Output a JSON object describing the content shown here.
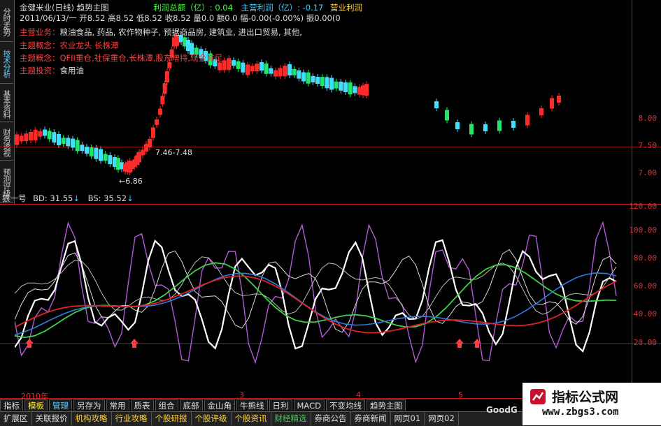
{
  "left_tabs": [
    {
      "label": "分时走势"
    },
    {
      "label": "技术分析"
    },
    {
      "label": "基本资料"
    },
    {
      "label": "财务透视"
    },
    {
      "label": "预测评级"
    }
  ],
  "header": {
    "stock": "金健米业(日线)",
    "view": "趋势主图",
    "fin1_label": "利润总额（亿）",
    "fin1_value": ": 0.04",
    "fin2_label": "主营利润（亿）",
    "fin2_value": ": -0.17",
    "fin3_label": "营业利润",
    "ohlc": "2011/06/13/一 开8.52 高8.52 低8.52 收8.52 量0.0 额0.0 幅-0.00(-0.00%) 振0.00(0",
    "business_label": "主营业务：",
    "business": "粮油食品, 药品, 农作物种子, 预据商品房, 建筑业, 进出口贸易, 其他,",
    "concept1_label": "主题概念：",
    "concept1": "农业龙头 长株潭",
    "concept2_label": "主题概念：",
    "concept2": "QFII重仓,社保重仓,长株潭,股东增持,现金充足",
    "invest_label": "主题投资：",
    "invest": "食用油"
  },
  "price_annotations": {
    "range": "7.46-7.48",
    "low": "6.86"
  },
  "upper_axis": [
    "8.00",
    "7.50",
    "7.00"
  ],
  "indicator": {
    "name": "狼一号",
    "bd": "BD: 31.55",
    "bs": "BS: 35.52"
  },
  "lower_axis": [
    "120.00",
    "100.00",
    "80.00",
    "60.00",
    "40.00",
    "20.00"
  ],
  "time_labels": [
    "2010年",
    "3",
    "4",
    "5"
  ],
  "bottom_tabs": [
    {
      "label": "指标",
      "state": "normal"
    },
    {
      "label": "模板",
      "state": "active"
    },
    {
      "label": "管理",
      "state": "sel"
    },
    {
      "label": "另存为",
      "state": "normal"
    },
    {
      "label": "常用",
      "state": "normal"
    },
    {
      "label": "质表",
      "state": "normal"
    },
    {
      "label": "组合",
      "state": "normal"
    },
    {
      "label": "底部",
      "state": "normal"
    },
    {
      "label": "金山角",
      "state": "normal"
    },
    {
      "label": "牛熊线",
      "state": "normal"
    },
    {
      "label": "日利",
      "state": "normal"
    },
    {
      "label": "MACD",
      "state": "normal"
    },
    {
      "label": "不变均线",
      "state": "normal"
    },
    {
      "label": "趋势主图",
      "state": "normal"
    }
  ],
  "bottom_bar": [
    {
      "label": "扩展区",
      "color": "normal"
    },
    {
      "label": "关联报价",
      "color": "normal"
    },
    {
      "label": "机构攻略",
      "color": "yel"
    },
    {
      "label": "行业攻略",
      "color": "yel"
    },
    {
      "label": "个股研报",
      "color": "yel"
    },
    {
      "label": "个股评级",
      "color": "yel"
    },
    {
      "label": "个股资讯",
      "color": "yel"
    },
    {
      "label": "财经精选",
      "color": "grn"
    },
    {
      "label": "券商公告",
      "color": "normal"
    },
    {
      "label": "券商新闻",
      "color": "normal"
    },
    {
      "label": "网页01",
      "color": "normal"
    },
    {
      "label": "网页02",
      "color": "normal"
    }
  ],
  "watermark": {
    "title": "指标公式网",
    "url": "www.zbgs3.com"
  },
  "footer_brand": "GoodG",
  "colors": {
    "up": "#ff2a2a",
    "down": "#27e36b",
    "down_alt": "#3de0ff",
    "grid": "#8a1010"
  }
}
